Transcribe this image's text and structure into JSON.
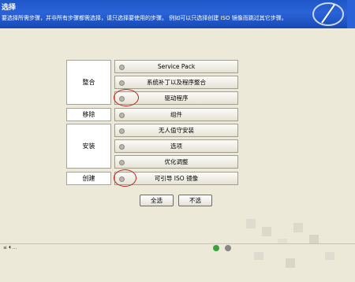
{
  "header": {
    "title": "选择",
    "subtitle": "要选择所需步骤，并非所有步骤都需选择，请只选择要使用的步骤。  例如可以只选择创建 ISO 镜像而跳过其它步骤。"
  },
  "groups": [
    {
      "label": "整合",
      "options": [
        "Service Pack",
        "系统补丁以及程序整合",
        "驱动程序"
      ]
    },
    {
      "label": "移除",
      "options": [
        "组件"
      ]
    },
    {
      "label": "安装",
      "options": [
        "无人值守安装",
        "选项",
        "优化调整"
      ]
    },
    {
      "label": "创建",
      "options": [
        "可引导 ISO 镜像"
      ]
    }
  ],
  "buttons": {
    "select_all": "全选",
    "select_none": "不选"
  },
  "statusbar": {
    "text": " ≤ ⏴ ... "
  },
  "colors": {
    "header_blue": "#2a63d7",
    "highlight_circle": "#c0241d"
  },
  "icons": [
    "app-logo-icon",
    "radio-icon",
    "status-green-icon",
    "status-gray-icon"
  ]
}
